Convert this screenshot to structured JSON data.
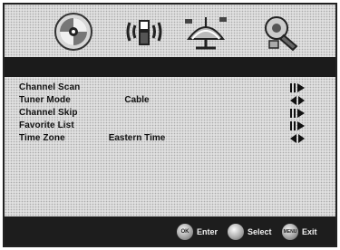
{
  "menu_icons": [
    {
      "name": "disc-icon"
    },
    {
      "name": "antenna-icon"
    },
    {
      "name": "satellite-dish-icon"
    },
    {
      "name": "settings-icon"
    }
  ],
  "items": [
    {
      "label": "Channel Scan",
      "value": "",
      "marker": "play"
    },
    {
      "label": "Tuner Mode",
      "value": "Cable",
      "marker": "lr"
    },
    {
      "label": "Channel Skip",
      "value": "",
      "marker": "play"
    },
    {
      "label": "Favorite List",
      "value": "",
      "marker": "play"
    },
    {
      "label": "Time Zone",
      "value": "Eastern Time",
      "marker": "lr"
    }
  ],
  "footer": {
    "ok_icon_text": "OK",
    "enter_label": "Enter",
    "select_label": "Select",
    "exit_icon_text": "MENU",
    "exit_label": "Exit"
  }
}
